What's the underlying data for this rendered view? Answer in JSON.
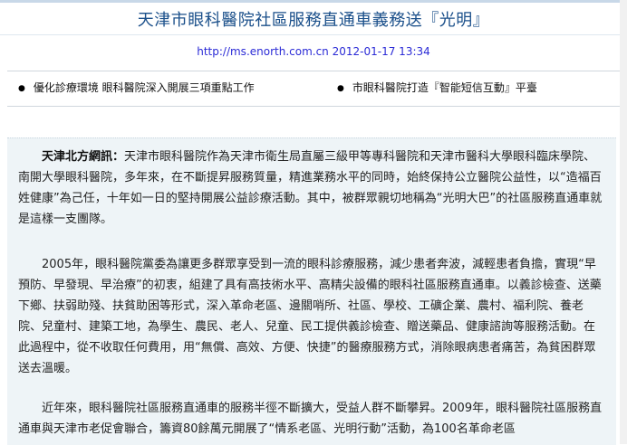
{
  "page": {
    "title": "天津市眼科醫院社區服務直通車義務送『光明』",
    "url": "http://ms.enorth.com.cn",
    "timestamp": "2012-01-17 13:34"
  },
  "related": [
    {
      "label": "優化診療環境 眼科醫院深入開展三項重點工作"
    },
    {
      "label": "市眼科醫院打造『智能短信互動』平臺"
    }
  ],
  "article": {
    "source_label": "天津北方網訊：",
    "p1_body": "天津市眼科醫院作為天津市衛生局直屬三級甲等專科醫院和天津市醫科大學眼科臨床學院、南開大學眼科醫院，多年來，在不斷提昇服務質量，精進業務水平的同時，始終保持公立醫院公益性，以“造福百姓健康”為己任，十年如一日的堅持開展公益診療活動。其中，被群眾親切地稱為“光明大巴”的社區服務直通車就是這樣一支團隊。",
    "p2": "2005年，眼科醫院黨委為讓更多群眾享受到一流的眼科診療服務，減少患者奔波，減輕患者負擔，實現“早預防、早發現、早治療”的初衷，組建了具有高技術水平、高精尖設備的眼科社區服務直通車。以義診檢查、送藥下鄉、扶弱助殘、扶貧助困等形式，深入革命老區、邊關哨所、社區、學校、工礦企業、農村、福利院、養老院、兒童村、建築工地，為學生、農民、老人、兒童、民工提供義診檢查、贈送藥品、健康諮詢等服務活動。在此過程中，從不收取任何費用，用“無償、高效、方便、快捷”的醫療服務方式，消除眼病患者痛苦，為貧困群眾送去溫暖。",
    "p3": "近年來，眼科醫院社區服務直通車的服務半徑不斷擴大，受益人群不斷攀昇。2009年，眼科醫院社區服務直通車與天津市老促會聯合，籌資80餘萬元開展了“情系老區、光明行動”活動，為100名革命老區"
  }
}
